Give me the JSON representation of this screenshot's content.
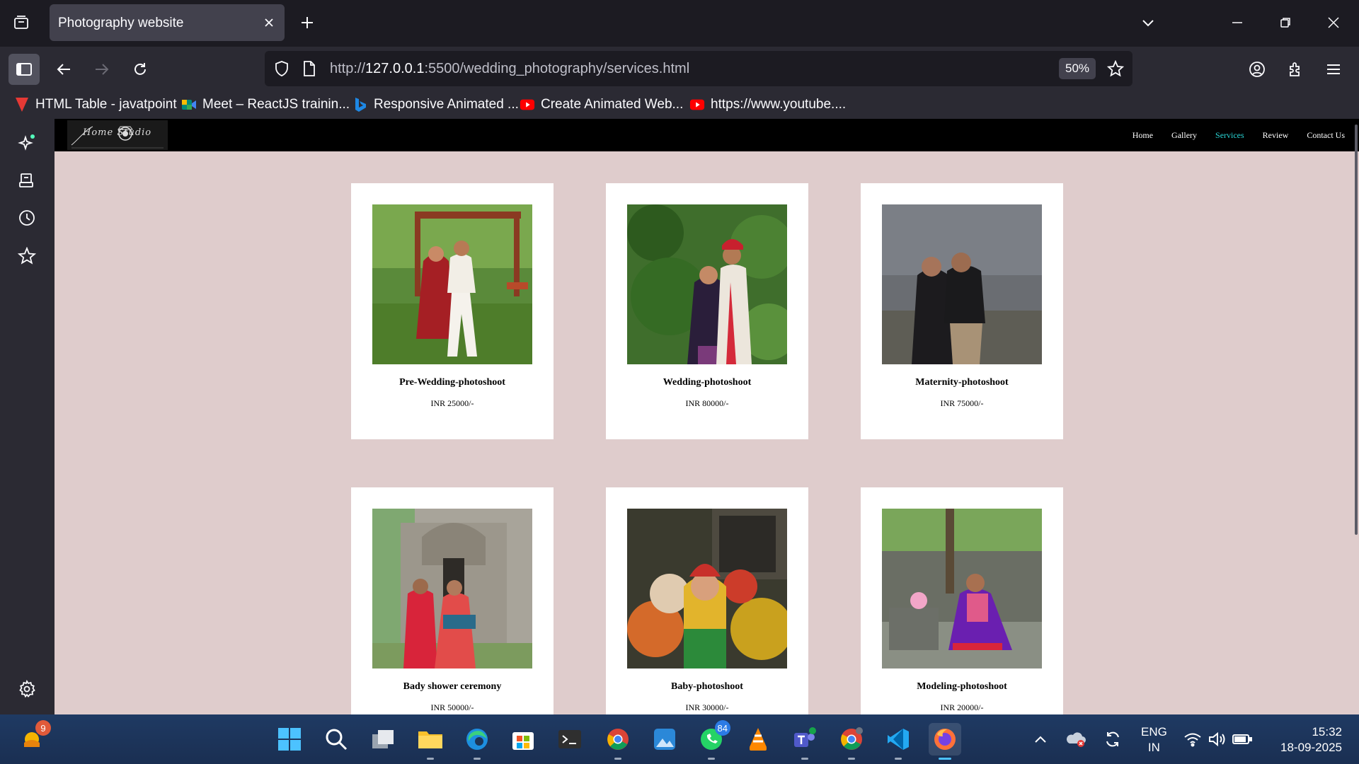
{
  "browser": {
    "tab": {
      "title": "Photography website"
    },
    "url": {
      "prefix": "http://",
      "host": "127.0.0.1",
      "rest": ":5500/wedding_photography/services.html"
    },
    "zoom": "50%",
    "bookmarks": [
      {
        "label": "HTML Table - javatpoint",
        "icon": "javatpoint-icon"
      },
      {
        "label": "Meet – ReactJS trainin...",
        "icon": "google-meet-icon"
      },
      {
        "label": "Responsive Animated ...",
        "icon": "bing-icon"
      },
      {
        "label": "Create Animated Web...",
        "icon": "youtube-icon"
      },
      {
        "label": "https://www.youtube....",
        "icon": "youtube-icon"
      }
    ]
  },
  "site": {
    "logo_text": "Home Studio",
    "nav": [
      {
        "label": "Home",
        "active": false
      },
      {
        "label": "Gallery",
        "active": false
      },
      {
        "label": "Services",
        "active": true
      },
      {
        "label": "Review",
        "active": false
      },
      {
        "label": "Contact Us",
        "active": false
      }
    ],
    "services": [
      {
        "title": "Pre-Wedding-photoshoot",
        "price": "INR 25000/-"
      },
      {
        "title": "Wedding-photoshoot",
        "price": "INR 80000/-"
      },
      {
        "title": "Maternity-photoshoot",
        "price": "INR 75000/-"
      },
      {
        "title": "Bady shower ceremony",
        "price": "INR 50000/-"
      },
      {
        "title": "Baby-photoshoot",
        "price": "INR 30000/-"
      },
      {
        "title": "Modeling-photoshoot",
        "price": "INR 20000/-"
      }
    ]
  },
  "taskbar": {
    "widgets_badge": "9",
    "whatsapp_badge": "84",
    "lang_line1": "ENG",
    "lang_line2": "IN",
    "time": "15:32",
    "date": "18-09-2025"
  },
  "colors": {
    "page_bg": "#dfcccc",
    "active_nav": "#29d6d6",
    "browser_bg": "#2b2a33"
  }
}
